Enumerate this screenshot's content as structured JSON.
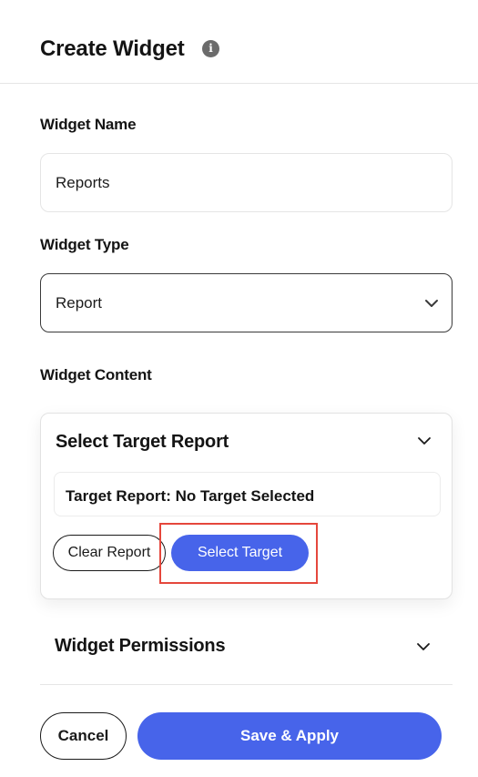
{
  "header": {
    "title": "Create Widget",
    "info_icon": "info-icon",
    "info_glyph": "i"
  },
  "widget_name": {
    "label": "Widget Name",
    "value": "Reports"
  },
  "widget_type": {
    "label": "Widget Type",
    "selected": "Report",
    "icon": "chevron-down-icon"
  },
  "widget_content": {
    "label": "Widget Content",
    "card_title": "Select Target Report",
    "target_text": "Target Report: No Target Selected",
    "clear_label": "Clear Report",
    "select_label": "Select Target"
  },
  "widget_permissions": {
    "title": "Widget Permissions"
  },
  "footer": {
    "cancel_label": "Cancel",
    "save_label": "Save & Apply"
  },
  "colors": {
    "accent": "#4764ea",
    "highlight": "#e5473c",
    "border": "#e5e5e5",
    "text": "#141414"
  }
}
